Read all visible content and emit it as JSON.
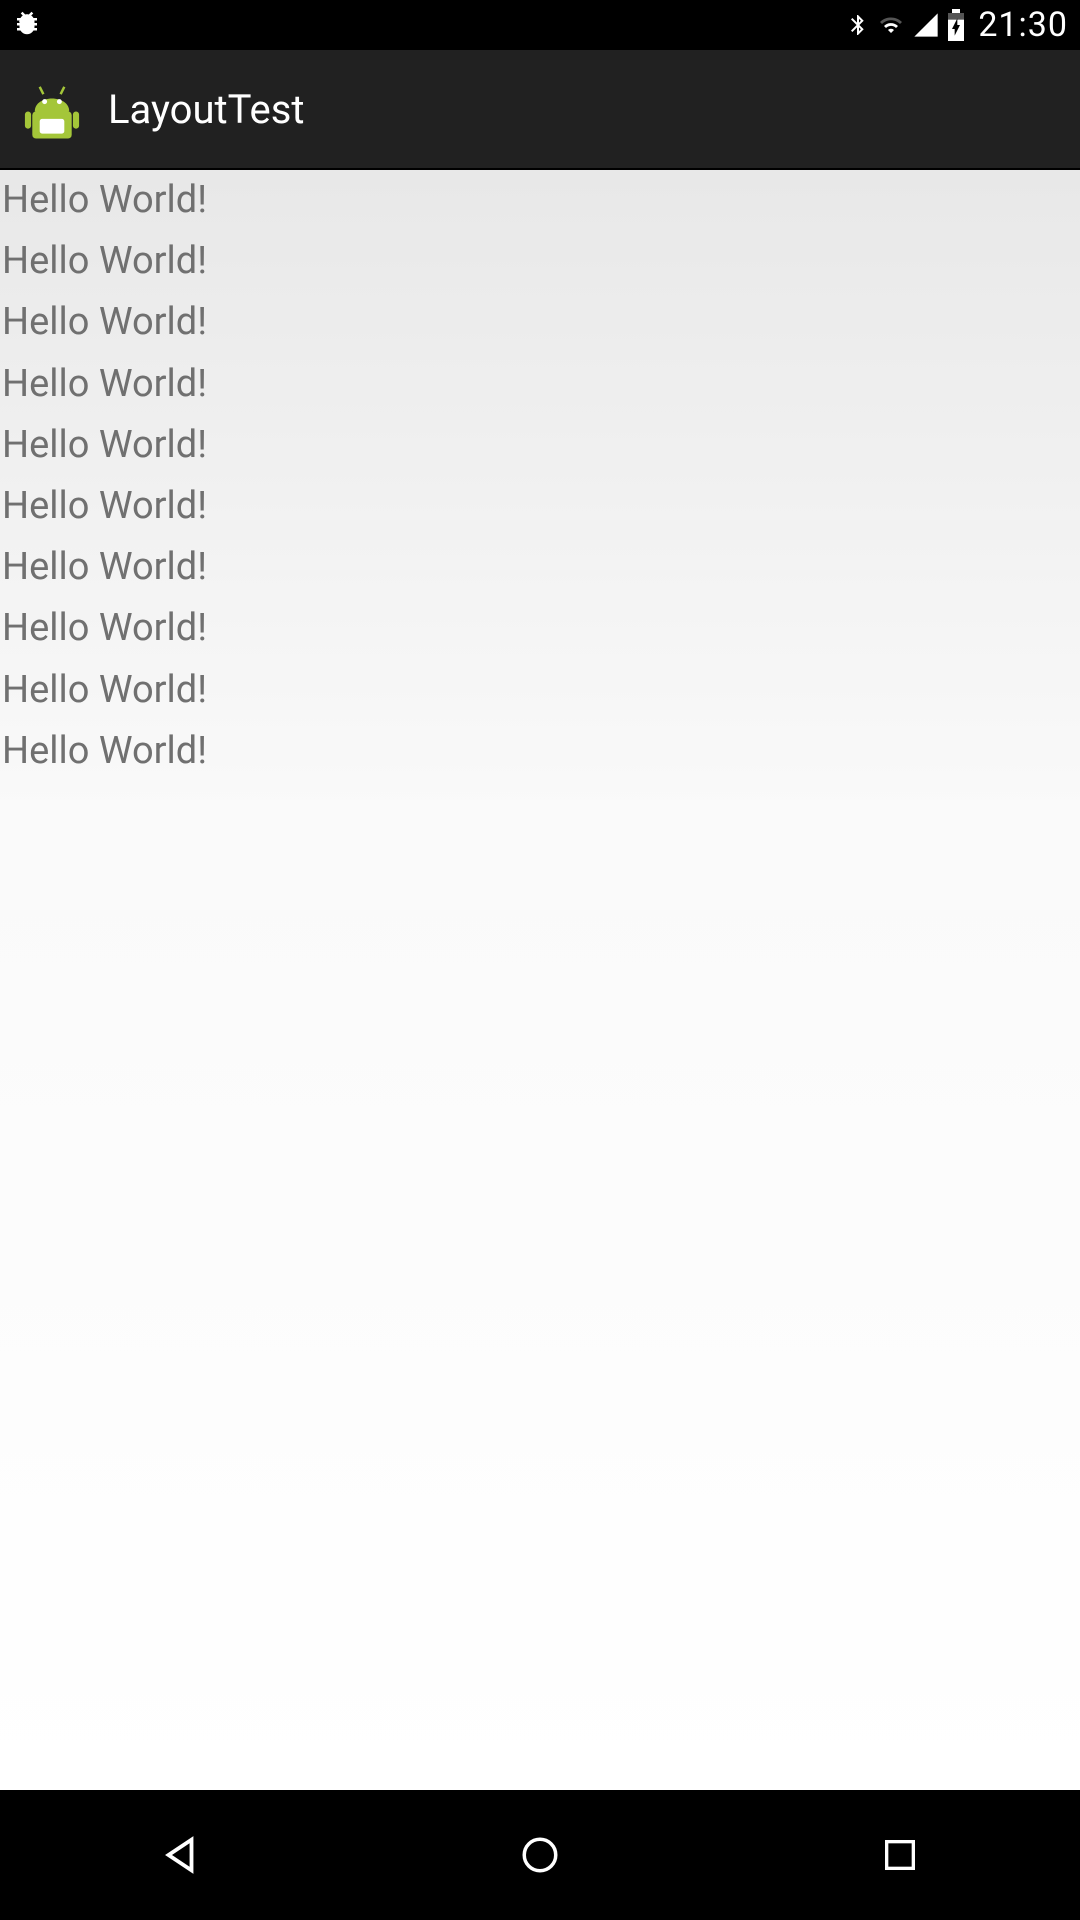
{
  "status_bar": {
    "time": "21:30"
  },
  "action_bar": {
    "title": "LayoutTest"
  },
  "content": {
    "lines": [
      "Hello World!",
      "Hello World!",
      "Hello World!",
      "Hello World!",
      "Hello World!",
      "Hello World!",
      "Hello World!",
      "Hello World!",
      "Hello World!",
      "Hello World!"
    ]
  }
}
